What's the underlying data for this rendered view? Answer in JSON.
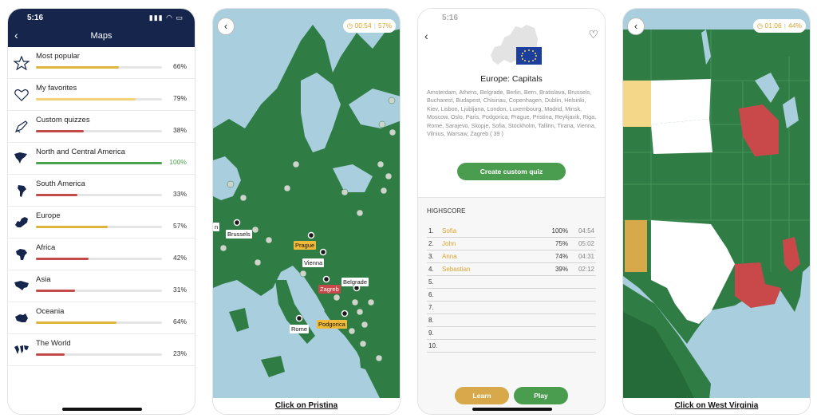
{
  "screen1": {
    "status_time": "5:16",
    "title": "Maps",
    "items": [
      {
        "label": "Most popular",
        "percent": "66%",
        "progress": 0.66,
        "color": "#e0b43c"
      },
      {
        "label": "My favorites",
        "percent": "79%",
        "progress": 0.79,
        "color": "#f2d27a"
      },
      {
        "label": "Custom quizzes",
        "percent": "38%",
        "progress": 0.38,
        "color": "#c44a4a"
      },
      {
        "label": "North and Central America",
        "percent": "100%",
        "progress": 1.0,
        "color": "#4aa24f"
      },
      {
        "label": "South America",
        "percent": "33%",
        "progress": 0.33,
        "color": "#c44a4a"
      },
      {
        "label": "Europe",
        "percent": "57%",
        "progress": 0.57,
        "color": "#e0b43c"
      },
      {
        "label": "Africa",
        "percent": "42%",
        "progress": 0.42,
        "color": "#c44a4a"
      },
      {
        "label": "Asia",
        "percent": "31%",
        "progress": 0.31,
        "color": "#c44a4a"
      },
      {
        "label": "Oceania",
        "percent": "64%",
        "progress": 0.64,
        "color": "#e0b43c"
      },
      {
        "label": "The World",
        "percent": "23%",
        "progress": 0.23,
        "color": "#c44a4a"
      }
    ]
  },
  "screen2": {
    "timer": "00:54",
    "percent": "57%",
    "prompt": "Click on Pristina",
    "cities": {
      "brussels": "Brussels",
      "prague": "Prague",
      "vienna": "Vienna",
      "zagreb": "Zagreb",
      "belgrade": "Belgrade",
      "rome": "Rome",
      "podgorica": "Podgorica",
      "edge": "n"
    }
  },
  "screen3": {
    "status_time": "5:16",
    "title": "Europe: Capitals",
    "capitals": "Amsterdam, Athens, Belgrade, Berlin, Bern, Bratislava, Brussels, Bucharest, Budapest, Chisinau, Copenhagen, Dublin, Helsinki, Kiev, Lisbon, Ljubljana, London, Luxembourg, Madrid, Minsk, Moscow, Oslo, Paris, Podgorica, Prague, Pristina, Reykjavik, Riga, Rome, Sarajevo, Skopje, Sofia, Stockholm, Tallinn, Tirana, Vienna, Vilnius, Warsaw, Zagreb ( 39 )",
    "create_label": "Create custom quiz",
    "highscore_title": "HIGHSCORE",
    "scores": [
      {
        "rank": "1.",
        "name": "Sofia",
        "percent": "100%",
        "time": "04:54"
      },
      {
        "rank": "2.",
        "name": "John",
        "percent": "75%",
        "time": "05:02"
      },
      {
        "rank": "3.",
        "name": "Anna",
        "percent": "74%",
        "time": "04:31"
      },
      {
        "rank": "4.",
        "name": "Sebastian",
        "percent": "39%",
        "time": "02:12"
      },
      {
        "rank": "5.",
        "name": "",
        "percent": "",
        "time": ""
      },
      {
        "rank": "6.",
        "name": "",
        "percent": "",
        "time": ""
      },
      {
        "rank": "7.",
        "name": "",
        "percent": "",
        "time": ""
      },
      {
        "rank": "8.",
        "name": "",
        "percent": "",
        "time": ""
      },
      {
        "rank": "9.",
        "name": "",
        "percent": "",
        "time": ""
      },
      {
        "rank": "10.",
        "name": "",
        "percent": "",
        "time": ""
      }
    ],
    "learn_label": "Learn",
    "play_label": "Play"
  },
  "screen4": {
    "timer": "01:06",
    "percent": "44%",
    "prompt": "Click on West Virginia"
  },
  "colors": {
    "navy": "#15254c",
    "map_green": "#2f7d45",
    "sea": "#a9cede",
    "correct_yellow": "#f0b93a",
    "wrong_red": "#c9484a",
    "button_green": "#4a9d4f"
  }
}
